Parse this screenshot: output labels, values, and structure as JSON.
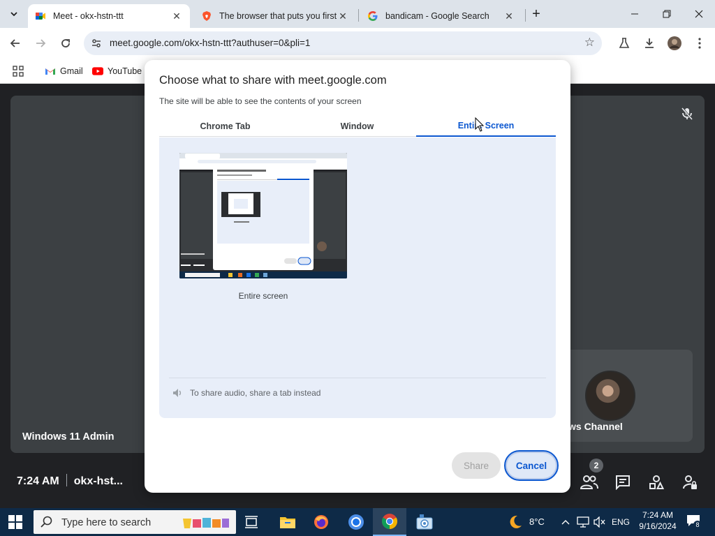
{
  "browser": {
    "tabs": [
      {
        "title": "Meet - okx-hstn-ttt",
        "active": true,
        "icon": "google-meet-icon"
      },
      {
        "title": "The browser that puts you first",
        "active": false,
        "icon": "brave-icon"
      },
      {
        "title": "bandicam - Google Search",
        "active": false,
        "icon": "google-icon"
      }
    ],
    "url": "meet.google.com/okx-hstn-ttt?authuser=0&pli=1",
    "bookmarks": [
      {
        "label": "Gmail",
        "icon": "gmail-icon"
      },
      {
        "label": "YouTube",
        "icon": "youtube-icon"
      }
    ]
  },
  "meet": {
    "main_participant": "Windows 11 Admin",
    "second_participant": "ws Channel",
    "time": "7:24 AM",
    "meeting_code": "okx-hst...",
    "people_count": "2"
  },
  "dialog": {
    "title": "Choose what to share with meet.google.com",
    "subtitle": "The site will be able to see the contents of your screen",
    "tabs": [
      "Chrome Tab",
      "Window",
      "Entire Screen"
    ],
    "active_tab": "Entire Screen",
    "source_label": "Entire screen",
    "audio_hint": "To share audio, share a tab instead",
    "share_label": "Share",
    "cancel_label": "Cancel"
  },
  "taskbar": {
    "search_placeholder": "Type here to search",
    "weather": "8°C",
    "language": "ENG",
    "time": "7:24 AM",
    "date": "9/16/2024",
    "notifications": "8"
  },
  "colors": {
    "accent": "#0b57d0",
    "meet_bg": "#202124",
    "tile_bg": "#3c4043",
    "taskbar_bg": "#0e2a47"
  }
}
